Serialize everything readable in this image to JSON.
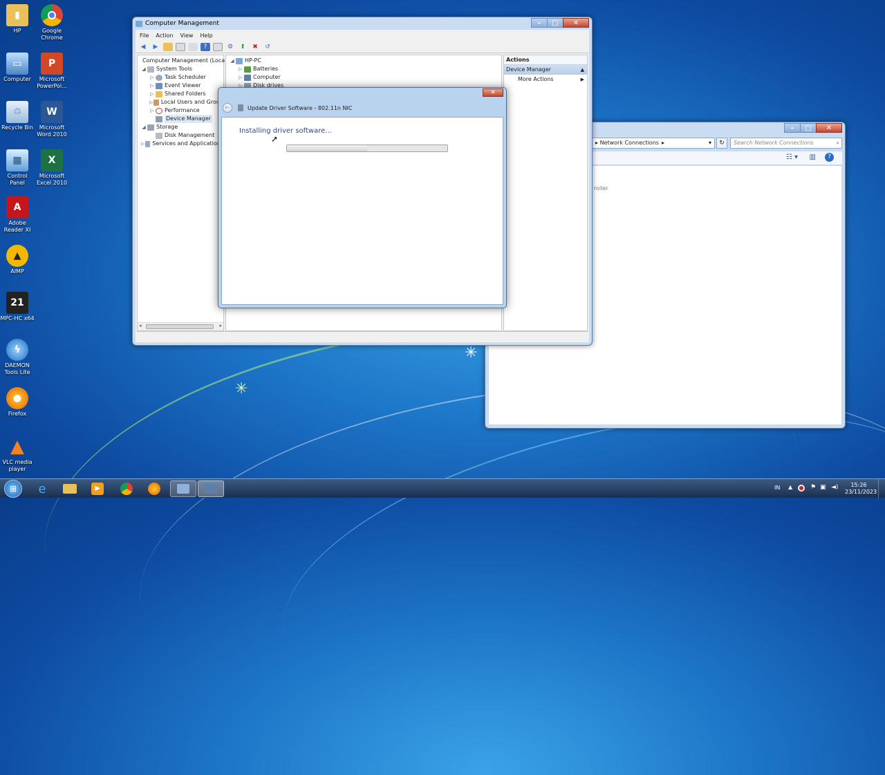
{
  "desktop": {
    "icons": [
      {
        "label": "HP",
        "icon": "folder-icon"
      },
      {
        "label": "Google Chrome",
        "icon": "chrome-icon"
      },
      {
        "label": "Computer",
        "icon": "computer-icon"
      },
      {
        "label": "Microsoft PowerPoi...",
        "icon": "powerpoint-icon"
      },
      {
        "label": "Recycle Bin",
        "icon": "recycle-bin-icon"
      },
      {
        "label": "Microsoft Word 2010",
        "icon": "word-icon"
      },
      {
        "label": "Control Panel",
        "icon": "control-panel-icon"
      },
      {
        "label": "Microsoft Excel 2010",
        "icon": "excel-icon"
      },
      {
        "label": "Adobe Reader XI",
        "icon": "adobe-reader-icon"
      },
      {
        "label": "AIMP",
        "icon": "aimp-icon"
      },
      {
        "label": "MPC-HC x64",
        "icon": "mpc-hc-icon"
      },
      {
        "label": "DAEMON Tools Lite",
        "icon": "daemon-tools-icon"
      },
      {
        "label": "Firefox",
        "icon": "firefox-icon"
      },
      {
        "label": "VLC media player",
        "icon": "vlc-icon"
      }
    ]
  },
  "computer_management": {
    "title": "Computer Management",
    "menu": [
      "File",
      "Action",
      "View",
      "Help"
    ],
    "left_tree": [
      {
        "label": "Computer Management (Local",
        "indent": 0,
        "arrow": ""
      },
      {
        "label": "System Tools",
        "indent": 1,
        "arrow": "◢"
      },
      {
        "label": "Task Scheduler",
        "indent": 2,
        "arrow": "▷"
      },
      {
        "label": "Event Viewer",
        "indent": 2,
        "arrow": "▷"
      },
      {
        "label": "Shared Folders",
        "indent": 2,
        "arrow": "▷"
      },
      {
        "label": "Local Users and Group",
        "indent": 2,
        "arrow": "▷"
      },
      {
        "label": "Performance",
        "indent": 2,
        "arrow": "▷"
      },
      {
        "label": "Device Manager",
        "indent": 2,
        "arrow": ""
      },
      {
        "label": "Storage",
        "indent": 1,
        "arrow": "◢"
      },
      {
        "label": "Disk Management",
        "indent": 2,
        "arrow": ""
      },
      {
        "label": "Services and Applications",
        "indent": 1,
        "arrow": "▷"
      }
    ],
    "device_tree": [
      {
        "label": "HP-PC",
        "indent": 0,
        "arrow": "◢"
      },
      {
        "label": "Batteries",
        "indent": 1,
        "arrow": "▷"
      },
      {
        "label": "Computer",
        "indent": 1,
        "arrow": "▷"
      },
      {
        "label": "Disk drives",
        "indent": 1,
        "arrow": "▷"
      }
    ],
    "actions": {
      "header": "Actions",
      "section": "Device Manager",
      "more": "More Actions"
    }
  },
  "network_window": {
    "breadcrumb": "Network Connections",
    "search_placeholder": "Search Network Connections",
    "partial_text": "roller"
  },
  "dialog": {
    "title": "Update Driver Software - 802.11n NIC",
    "status": "Installing driver software...",
    "progress": 0.5
  },
  "taskbar": {
    "time": "15:26",
    "date": "23/11/2023",
    "lang": "IN"
  }
}
